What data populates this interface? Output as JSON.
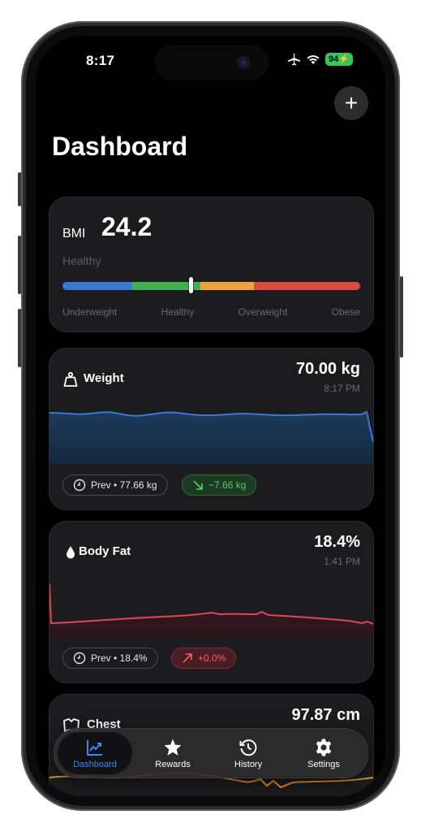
{
  "status_bar": {
    "time": "8:17",
    "battery": "94"
  },
  "header": {
    "title": "Dashboard",
    "add_label": "+"
  },
  "bmi": {
    "label": "BMI",
    "value": "24.2",
    "status": "Healthy",
    "marker_position_fraction": 0.43,
    "categories": [
      "Underweight",
      "Healthy",
      "Overweight",
      "Obese"
    ],
    "colors": [
      "#3a78d8",
      "#41b04f",
      "#f2a03c",
      "#d94a42"
    ]
  },
  "weight": {
    "name": "Weight",
    "value": "70.00 kg",
    "time": "8:17 PM",
    "prev": "Prev • 77.66 kg",
    "delta": "−7.66 kg",
    "accent": "#3a78d8"
  },
  "body_fat": {
    "name": "Body Fat",
    "value": "18.4%",
    "time": "1:41 PM",
    "prev": "Prev • 18.4%",
    "delta": "+0.0%",
    "accent": "#e0455a"
  },
  "chest": {
    "name": "Chest",
    "value": "97.87 cm",
    "accent": "#e8962e"
  },
  "tabs": [
    {
      "label": "Dashboard",
      "icon": "chart-line-icon",
      "active": true
    },
    {
      "label": "Rewards",
      "icon": "star-icon",
      "active": false
    },
    {
      "label": "History",
      "icon": "history-clock-icon",
      "active": false
    },
    {
      "label": "Settings",
      "icon": "gear-icon",
      "active": false
    }
  ]
}
